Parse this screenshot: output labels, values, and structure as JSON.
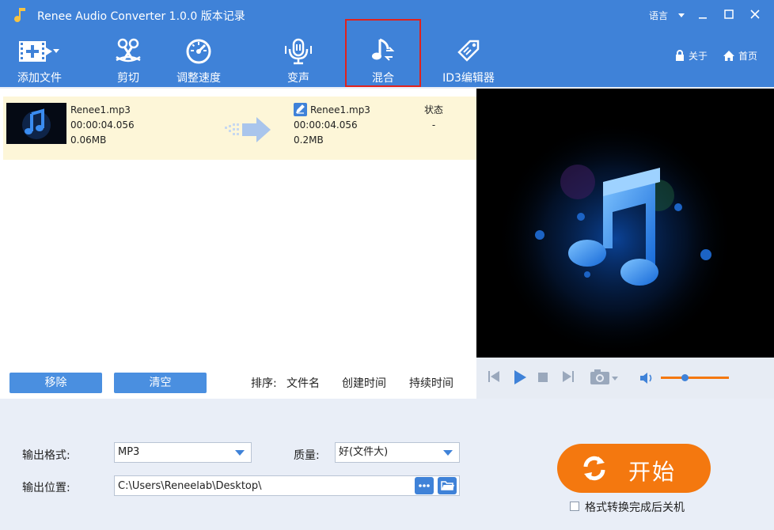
{
  "window": {
    "title": "Renee Audio Converter 1.0.0 版本记录",
    "language": "语言"
  },
  "toolbar": {
    "items": [
      {
        "id": "add-file",
        "label": "添加文件",
        "icon": "film-add-icon"
      },
      {
        "id": "cut",
        "label": "剪切",
        "icon": "scissors-icon"
      },
      {
        "id": "speed",
        "label": "调整速度",
        "icon": "speedometer-icon"
      },
      {
        "id": "voice",
        "label": "变声",
        "icon": "microphone-icon"
      },
      {
        "id": "mix",
        "label": "混合",
        "icon": "music-mix-icon",
        "active": true
      },
      {
        "id": "id3",
        "label": "ID3编辑器",
        "icon": "tag-edit-icon"
      }
    ],
    "about": "关于",
    "home": "首页"
  },
  "file": {
    "source_name": "Renee1.mp3",
    "source_duration": "00:00:04.056",
    "source_size": "0.06MB",
    "output_name": "Renee1.mp3",
    "output_duration": "00:00:04.056",
    "output_size": "0.2MB",
    "status_header": "状态",
    "status_value": "-"
  },
  "list_footer": {
    "remove": "移除",
    "clear": "清空",
    "sort_label": "排序:",
    "sort_options": [
      "文件名",
      "创建时间",
      "持续时间"
    ]
  },
  "settings": {
    "format_label": "输出格式:",
    "format_value": "MP3",
    "quality_label": "质量:",
    "quality_value": "好(文件大)",
    "location_label": "输出位置:",
    "location_value": "C:\\Users\\Reneelab\\Desktop\\",
    "start": "开始",
    "shutdown_label": "格式转换完成后关机"
  },
  "player": {
    "volume_fraction": 0.35
  },
  "colors": {
    "brand_blue": "#3f82d8",
    "start_orange": "#f4780f",
    "active_outline": "#e0221d",
    "row_highlight": "#fdf6d8"
  }
}
